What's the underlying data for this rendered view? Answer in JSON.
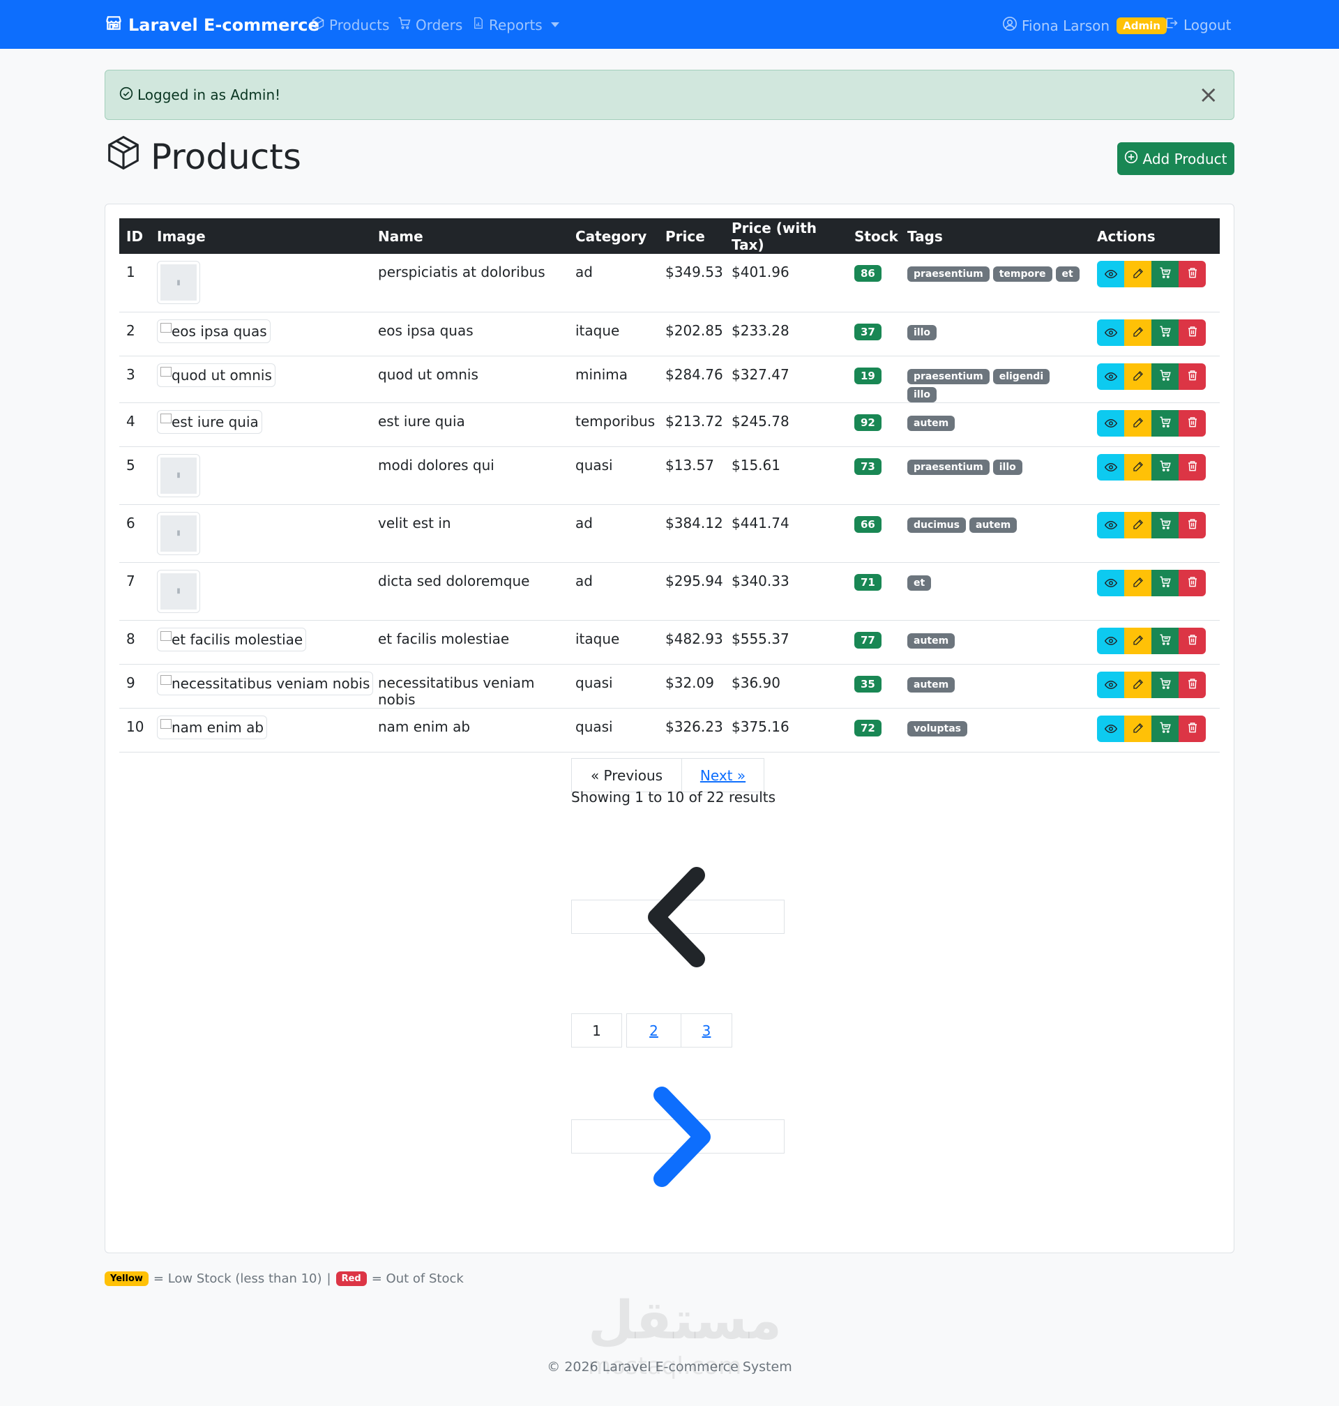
{
  "navbar": {
    "brand": "Laravel E-commerce",
    "links": [
      "Products",
      "Orders",
      "Reports"
    ],
    "user_name": "Fiona Larson",
    "role_badge": "Admin",
    "logout": "Logout"
  },
  "alert": {
    "text": "Logged in as Admin!",
    "close": "×"
  },
  "page": {
    "title": "Products",
    "add_button": "Add Product"
  },
  "table": {
    "headers": [
      "ID",
      "Image",
      "Name",
      "Category",
      "Price",
      "Price (with Tax)",
      "Stock",
      "Tags",
      "Actions"
    ],
    "rows": [
      {
        "id": "1",
        "image": "",
        "name": "perspiciatis at doloribus",
        "category": "ad",
        "price": "$349.53",
        "price_tax": "$401.96",
        "stock": "86",
        "tags": [
          "praesentium",
          "tempore",
          "et"
        ]
      },
      {
        "id": "2",
        "image": "eos ipsa quas",
        "name": "eos ipsa quas",
        "category": "itaque",
        "price": "$202.85",
        "price_tax": "$233.28",
        "stock": "37",
        "tags": [
          "illo"
        ]
      },
      {
        "id": "3",
        "image": "quod ut omnis",
        "name": "quod ut omnis",
        "category": "minima",
        "price": "$284.76",
        "price_tax": "$327.47",
        "stock": "19",
        "tags": [
          "praesentium",
          "eligendi",
          "illo"
        ]
      },
      {
        "id": "4",
        "image": "est iure quia",
        "name": "est iure quia",
        "category": "temporibus",
        "price": "$213.72",
        "price_tax": "$245.78",
        "stock": "92",
        "tags": [
          "autem"
        ]
      },
      {
        "id": "5",
        "image": "",
        "name": "modi dolores qui",
        "category": "quasi",
        "price": "$13.57",
        "price_tax": "$15.61",
        "stock": "73",
        "tags": [
          "praesentium",
          "illo"
        ]
      },
      {
        "id": "6",
        "image": "",
        "name": "velit est in",
        "category": "ad",
        "price": "$384.12",
        "price_tax": "$441.74",
        "stock": "66",
        "tags": [
          "ducimus",
          "autem"
        ]
      },
      {
        "id": "7",
        "image": "",
        "name": "dicta sed doloremque",
        "category": "ad",
        "price": "$295.94",
        "price_tax": "$340.33",
        "stock": "71",
        "tags": [
          "et"
        ]
      },
      {
        "id": "8",
        "image": "et facilis molestiae",
        "name": "et facilis molestiae",
        "category": "itaque",
        "price": "$482.93",
        "price_tax": "$555.37",
        "stock": "77",
        "tags": [
          "autem"
        ]
      },
      {
        "id": "9",
        "image": "necessitatibus veniam nobis",
        "name": "necessitatibus veniam nobis",
        "category": "quasi",
        "price": "$32.09",
        "price_tax": "$36.90",
        "stock": "35",
        "tags": [
          "autem"
        ]
      },
      {
        "id": "10",
        "image": "nam enim ab",
        "name": "nam enim ab",
        "category": "quasi",
        "price": "$326.23",
        "price_tax": "$375.16",
        "stock": "72",
        "tags": [
          "voluptas"
        ]
      }
    ]
  },
  "pagination": {
    "previous": "« Previous",
    "next": "Next »",
    "showing": "Showing 1 to 10 of 22 results",
    "pages": [
      "1",
      "2",
      "3"
    ],
    "current_page": "1"
  },
  "legend": {
    "yellow_badge": "Yellow",
    "yellow_text": "= Low Stock (less than 10)",
    "separator": "|",
    "red_badge": "Red",
    "red_text": "= Out of Stock"
  },
  "footer": {
    "text": "© 2026 Laravel E-commerce System"
  },
  "watermark": {
    "arabic": "مستقل",
    "latin": "mostaql.com"
  },
  "colors": {
    "primary": "#0d6efd",
    "success": "#198754",
    "warning": "#ffc107",
    "danger": "#dc3545",
    "info": "#0dcaf0",
    "secondary": "#6c757d",
    "dark": "#212529"
  }
}
